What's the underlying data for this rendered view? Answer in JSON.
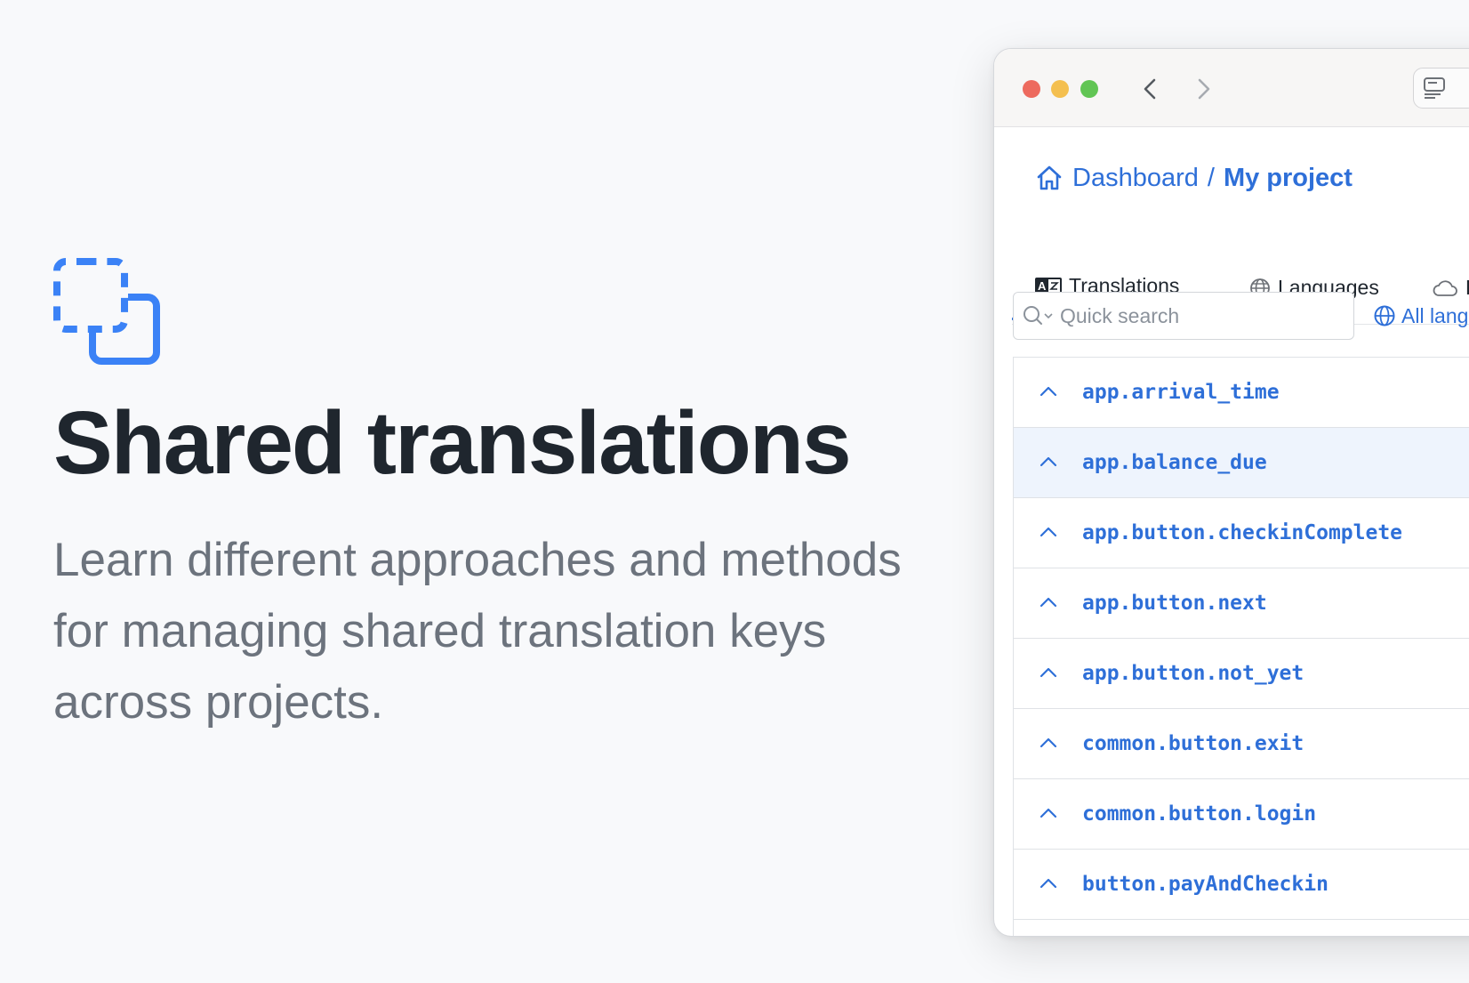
{
  "hero": {
    "icon": "shared-copy-icon",
    "title": "Shared translations",
    "description": "Learn different approaches and methods for managing shared translation keys across projects."
  },
  "colors": {
    "accent": "#2e6fd8",
    "icon_blue": "#3b82f6",
    "title": "#1f262e",
    "muted": "#6c737d",
    "highlight_row": "#eef4fd"
  },
  "window": {
    "breadcrumb": {
      "parent": "Dashboard",
      "separator": "/",
      "current": "My project"
    },
    "tabs": [
      {
        "label": "Translations",
        "icon": "translate-icon",
        "active": true
      },
      {
        "label": "Languages",
        "icon": "globe-icon",
        "active": false
      },
      {
        "label": "Ho",
        "icon": "cloud-icon",
        "active": false
      }
    ],
    "search": {
      "placeholder": "Quick search"
    },
    "language_filter": {
      "label": "All lang"
    },
    "keys": [
      "app.arrival_time",
      "app.balance_due",
      "app.button.checkinComplete",
      "app.button.next",
      "app.button.not_yet",
      "common.button.exit",
      "common.button.login",
      "button.payAndCheckin"
    ]
  }
}
